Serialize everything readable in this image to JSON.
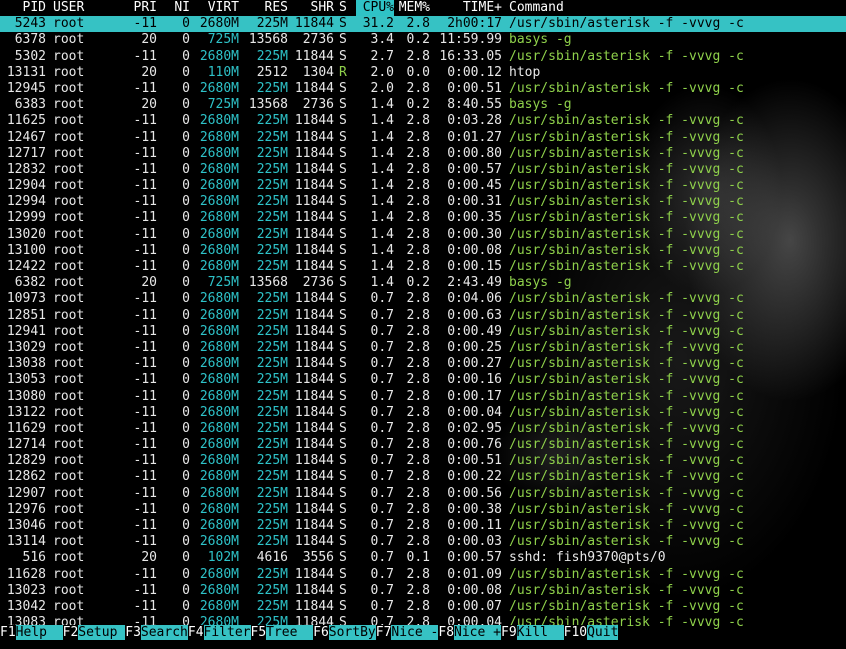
{
  "header": {
    "pid": "PID",
    "user": "USER",
    "pri": "PRI",
    "ni": "NI",
    "virt": "VIRT",
    "res": "RES",
    "shr": "SHR",
    "s": "S",
    "cpu": "CPU%",
    "mem": "MEM%",
    "time": "TIME+",
    "cmd": "Command"
  },
  "colors": {
    "accent_cyan": "#36c2c4",
    "command_green": "#8fd14b",
    "memory_cyan": "#2ec2c8"
  },
  "processes": [
    {
      "pid": "5243",
      "user": "root",
      "pri": "-11",
      "ni": "0",
      "virt": "2680M",
      "res": "225M",
      "shr": "11844",
      "s": "S",
      "cpu": "31.2",
      "mem": "2.8",
      "time": "2h00:17",
      "cmd": "/usr/sbin/asterisk -f -vvvg -c"
    },
    {
      "pid": "6378",
      "user": "root",
      "pri": "20",
      "ni": "0",
      "virt": "725M",
      "res": "13568",
      "shr": "2736",
      "s": "S",
      "cpu": "3.4",
      "mem": "0.2",
      "time": "11:59.99",
      "cmd": "basys -g"
    },
    {
      "pid": "5302",
      "user": "root",
      "pri": "-11",
      "ni": "0",
      "virt": "2680M",
      "res": "225M",
      "shr": "11844",
      "s": "S",
      "cpu": "2.7",
      "mem": "2.8",
      "time": "16:33.05",
      "cmd": "/usr/sbin/asterisk -f -vvvg -c"
    },
    {
      "pid": "13131",
      "user": "root",
      "pri": "20",
      "ni": "0",
      "virt": "110M",
      "res": "2512",
      "shr": "1304",
      "s": "R",
      "cpu": "2.0",
      "mem": "0.0",
      "time": "0:00.12",
      "cmd": "htop"
    },
    {
      "pid": "12945",
      "user": "root",
      "pri": "-11",
      "ni": "0",
      "virt": "2680M",
      "res": "225M",
      "shr": "11844",
      "s": "S",
      "cpu": "2.0",
      "mem": "2.8",
      "time": "0:00.51",
      "cmd": "/usr/sbin/asterisk -f -vvvg -c"
    },
    {
      "pid": "6383",
      "user": "root",
      "pri": "20",
      "ni": "0",
      "virt": "725M",
      "res": "13568",
      "shr": "2736",
      "s": "S",
      "cpu": "1.4",
      "mem": "0.2",
      "time": "8:40.55",
      "cmd": "basys -g"
    },
    {
      "pid": "11625",
      "user": "root",
      "pri": "-11",
      "ni": "0",
      "virt": "2680M",
      "res": "225M",
      "shr": "11844",
      "s": "S",
      "cpu": "1.4",
      "mem": "2.8",
      "time": "0:03.28",
      "cmd": "/usr/sbin/asterisk -f -vvvg -c"
    },
    {
      "pid": "12467",
      "user": "root",
      "pri": "-11",
      "ni": "0",
      "virt": "2680M",
      "res": "225M",
      "shr": "11844",
      "s": "S",
      "cpu": "1.4",
      "mem": "2.8",
      "time": "0:01.27",
      "cmd": "/usr/sbin/asterisk -f -vvvg -c"
    },
    {
      "pid": "12717",
      "user": "root",
      "pri": "-11",
      "ni": "0",
      "virt": "2680M",
      "res": "225M",
      "shr": "11844",
      "s": "S",
      "cpu": "1.4",
      "mem": "2.8",
      "time": "0:00.80",
      "cmd": "/usr/sbin/asterisk -f -vvvg -c"
    },
    {
      "pid": "12832",
      "user": "root",
      "pri": "-11",
      "ni": "0",
      "virt": "2680M",
      "res": "225M",
      "shr": "11844",
      "s": "S",
      "cpu": "1.4",
      "mem": "2.8",
      "time": "0:00.57",
      "cmd": "/usr/sbin/asterisk -f -vvvg -c"
    },
    {
      "pid": "12904",
      "user": "root",
      "pri": "-11",
      "ni": "0",
      "virt": "2680M",
      "res": "225M",
      "shr": "11844",
      "s": "S",
      "cpu": "1.4",
      "mem": "2.8",
      "time": "0:00.45",
      "cmd": "/usr/sbin/asterisk -f -vvvg -c"
    },
    {
      "pid": "12994",
      "user": "root",
      "pri": "-11",
      "ni": "0",
      "virt": "2680M",
      "res": "225M",
      "shr": "11844",
      "s": "S",
      "cpu": "1.4",
      "mem": "2.8",
      "time": "0:00.31",
      "cmd": "/usr/sbin/asterisk -f -vvvg -c"
    },
    {
      "pid": "12999",
      "user": "root",
      "pri": "-11",
      "ni": "0",
      "virt": "2680M",
      "res": "225M",
      "shr": "11844",
      "s": "S",
      "cpu": "1.4",
      "mem": "2.8",
      "time": "0:00.35",
      "cmd": "/usr/sbin/asterisk -f -vvvg -c"
    },
    {
      "pid": "13020",
      "user": "root",
      "pri": "-11",
      "ni": "0",
      "virt": "2680M",
      "res": "225M",
      "shr": "11844",
      "s": "S",
      "cpu": "1.4",
      "mem": "2.8",
      "time": "0:00.30",
      "cmd": "/usr/sbin/asterisk -f -vvvg -c"
    },
    {
      "pid": "13100",
      "user": "root",
      "pri": "-11",
      "ni": "0",
      "virt": "2680M",
      "res": "225M",
      "shr": "11844",
      "s": "S",
      "cpu": "1.4",
      "mem": "2.8",
      "time": "0:00.08",
      "cmd": "/usr/sbin/asterisk -f -vvvg -c"
    },
    {
      "pid": "12422",
      "user": "root",
      "pri": "-11",
      "ni": "0",
      "virt": "2680M",
      "res": "225M",
      "shr": "11844",
      "s": "S",
      "cpu": "1.4",
      "mem": "2.8",
      "time": "0:00.15",
      "cmd": "/usr/sbin/asterisk -f -vvvg -c"
    },
    {
      "pid": "6382",
      "user": "root",
      "pri": "20",
      "ni": "0",
      "virt": "725M",
      "res": "13568",
      "shr": "2736",
      "s": "S",
      "cpu": "1.4",
      "mem": "0.2",
      "time": "2:43.49",
      "cmd": "basys -g"
    },
    {
      "pid": "10973",
      "user": "root",
      "pri": "-11",
      "ni": "0",
      "virt": "2680M",
      "res": "225M",
      "shr": "11844",
      "s": "S",
      "cpu": "0.7",
      "mem": "2.8",
      "time": "0:04.06",
      "cmd": "/usr/sbin/asterisk -f -vvvg -c"
    },
    {
      "pid": "12851",
      "user": "root",
      "pri": "-11",
      "ni": "0",
      "virt": "2680M",
      "res": "225M",
      "shr": "11844",
      "s": "S",
      "cpu": "0.7",
      "mem": "2.8",
      "time": "0:00.63",
      "cmd": "/usr/sbin/asterisk -f -vvvg -c"
    },
    {
      "pid": "12941",
      "user": "root",
      "pri": "-11",
      "ni": "0",
      "virt": "2680M",
      "res": "225M",
      "shr": "11844",
      "s": "S",
      "cpu": "0.7",
      "mem": "2.8",
      "time": "0:00.49",
      "cmd": "/usr/sbin/asterisk -f -vvvg -c"
    },
    {
      "pid": "13029",
      "user": "root",
      "pri": "-11",
      "ni": "0",
      "virt": "2680M",
      "res": "225M",
      "shr": "11844",
      "s": "S",
      "cpu": "0.7",
      "mem": "2.8",
      "time": "0:00.25",
      "cmd": "/usr/sbin/asterisk -f -vvvg -c"
    },
    {
      "pid": "13038",
      "user": "root",
      "pri": "-11",
      "ni": "0",
      "virt": "2680M",
      "res": "225M",
      "shr": "11844",
      "s": "S",
      "cpu": "0.7",
      "mem": "2.8",
      "time": "0:00.27",
      "cmd": "/usr/sbin/asterisk -f -vvvg -c"
    },
    {
      "pid": "13053",
      "user": "root",
      "pri": "-11",
      "ni": "0",
      "virt": "2680M",
      "res": "225M",
      "shr": "11844",
      "s": "S",
      "cpu": "0.7",
      "mem": "2.8",
      "time": "0:00.16",
      "cmd": "/usr/sbin/asterisk -f -vvvg -c"
    },
    {
      "pid": "13080",
      "user": "root",
      "pri": "-11",
      "ni": "0",
      "virt": "2680M",
      "res": "225M",
      "shr": "11844",
      "s": "S",
      "cpu": "0.7",
      "mem": "2.8",
      "time": "0:00.17",
      "cmd": "/usr/sbin/asterisk -f -vvvg -c"
    },
    {
      "pid": "13122",
      "user": "root",
      "pri": "-11",
      "ni": "0",
      "virt": "2680M",
      "res": "225M",
      "shr": "11844",
      "s": "S",
      "cpu": "0.7",
      "mem": "2.8",
      "time": "0:00.04",
      "cmd": "/usr/sbin/asterisk -f -vvvg -c"
    },
    {
      "pid": "11629",
      "user": "root",
      "pri": "-11",
      "ni": "0",
      "virt": "2680M",
      "res": "225M",
      "shr": "11844",
      "s": "S",
      "cpu": "0.7",
      "mem": "2.8",
      "time": "0:02.95",
      "cmd": "/usr/sbin/asterisk -f -vvvg -c"
    },
    {
      "pid": "12714",
      "user": "root",
      "pri": "-11",
      "ni": "0",
      "virt": "2680M",
      "res": "225M",
      "shr": "11844",
      "s": "S",
      "cpu": "0.7",
      "mem": "2.8",
      "time": "0:00.76",
      "cmd": "/usr/sbin/asterisk -f -vvvg -c"
    },
    {
      "pid": "12829",
      "user": "root",
      "pri": "-11",
      "ni": "0",
      "virt": "2680M",
      "res": "225M",
      "shr": "11844",
      "s": "S",
      "cpu": "0.7",
      "mem": "2.8",
      "time": "0:00.51",
      "cmd": "/usr/sbin/asterisk -f -vvvg -c"
    },
    {
      "pid": "12862",
      "user": "root",
      "pri": "-11",
      "ni": "0",
      "virt": "2680M",
      "res": "225M",
      "shr": "11844",
      "s": "S",
      "cpu": "0.7",
      "mem": "2.8",
      "time": "0:00.22",
      "cmd": "/usr/sbin/asterisk -f -vvvg -c"
    },
    {
      "pid": "12907",
      "user": "root",
      "pri": "-11",
      "ni": "0",
      "virt": "2680M",
      "res": "225M",
      "shr": "11844",
      "s": "S",
      "cpu": "0.7",
      "mem": "2.8",
      "time": "0:00.56",
      "cmd": "/usr/sbin/asterisk -f -vvvg -c"
    },
    {
      "pid": "12976",
      "user": "root",
      "pri": "-11",
      "ni": "0",
      "virt": "2680M",
      "res": "225M",
      "shr": "11844",
      "s": "S",
      "cpu": "0.7",
      "mem": "2.8",
      "time": "0:00.38",
      "cmd": "/usr/sbin/asterisk -f -vvvg -c"
    },
    {
      "pid": "13046",
      "user": "root",
      "pri": "-11",
      "ni": "0",
      "virt": "2680M",
      "res": "225M",
      "shr": "11844",
      "s": "S",
      "cpu": "0.7",
      "mem": "2.8",
      "time": "0:00.11",
      "cmd": "/usr/sbin/asterisk -f -vvvg -c"
    },
    {
      "pid": "13114",
      "user": "root",
      "pri": "-11",
      "ni": "0",
      "virt": "2680M",
      "res": "225M",
      "shr": "11844",
      "s": "S",
      "cpu": "0.7",
      "mem": "2.8",
      "time": "0:00.03",
      "cmd": "/usr/sbin/asterisk -f -vvvg -c"
    },
    {
      "pid": "516",
      "user": "root",
      "pri": "20",
      "ni": "0",
      "virt": "102M",
      "res": "4616",
      "shr": "3556",
      "s": "S",
      "cpu": "0.7",
      "mem": "0.1",
      "time": "0:00.57",
      "cmd": "sshd: fish9370@pts/0"
    },
    {
      "pid": "11628",
      "user": "root",
      "pri": "-11",
      "ni": "0",
      "virt": "2680M",
      "res": "225M",
      "shr": "11844",
      "s": "S",
      "cpu": "0.7",
      "mem": "2.8",
      "time": "0:01.09",
      "cmd": "/usr/sbin/asterisk -f -vvvg -c"
    },
    {
      "pid": "13023",
      "user": "root",
      "pri": "-11",
      "ni": "0",
      "virt": "2680M",
      "res": "225M",
      "shr": "11844",
      "s": "S",
      "cpu": "0.7",
      "mem": "2.8",
      "time": "0:00.08",
      "cmd": "/usr/sbin/asterisk -f -vvvg -c"
    },
    {
      "pid": "13042",
      "user": "root",
      "pri": "-11",
      "ni": "0",
      "virt": "2680M",
      "res": "225M",
      "shr": "11844",
      "s": "S",
      "cpu": "0.7",
      "mem": "2.8",
      "time": "0:00.07",
      "cmd": "/usr/sbin/asterisk -f -vvvg -c"
    },
    {
      "pid": "13083",
      "user": "root",
      "pri": "-11",
      "ni": "0",
      "virt": "2680M",
      "res": "225M",
      "shr": "11844",
      "s": "S",
      "cpu": "0.7",
      "mem": "2.8",
      "time": "0:00.04",
      "cmd": "/usr/sbin/asterisk -f -vvvg -c"
    }
  ],
  "footer": {
    "keys": [
      {
        "key": "F1",
        "label": "Help  "
      },
      {
        "key": "F2",
        "label": "Setup "
      },
      {
        "key": "F3",
        "label": "Search"
      },
      {
        "key": "F4",
        "label": "Filter"
      },
      {
        "key": "F5",
        "label": "Tree  "
      },
      {
        "key": "F6",
        "label": "SortBy"
      },
      {
        "key": "F7",
        "label": "Nice -"
      },
      {
        "key": "F8",
        "label": "Nice +"
      },
      {
        "key": "F9",
        "label": "Kill  "
      },
      {
        "key": "F10",
        "label": "Quit"
      }
    ]
  }
}
